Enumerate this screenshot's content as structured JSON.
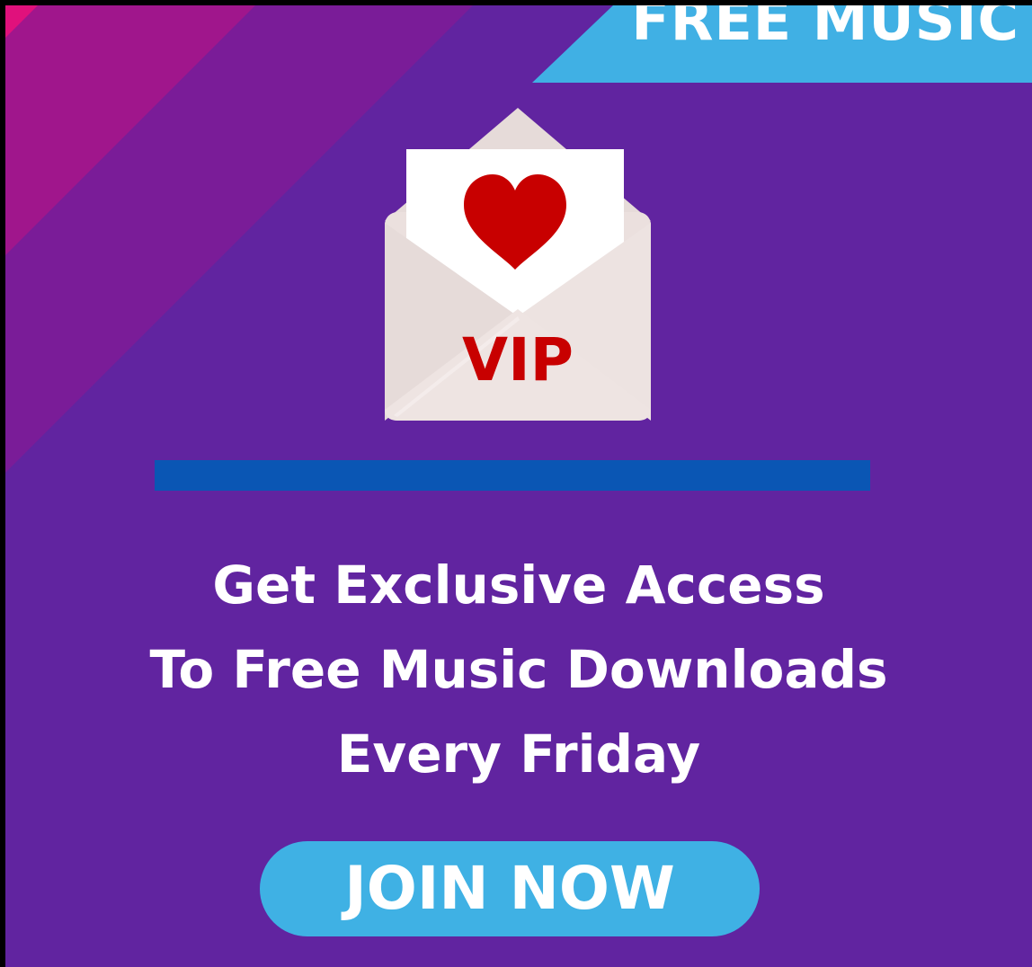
{
  "ribbon": {
    "label": "FREE MUSIC",
    "color": "#40b0e4"
  },
  "envelope": {
    "icon": "heart-icon",
    "badge": "VIP",
    "badge_color": "#c80000",
    "heart_color": "#c80000"
  },
  "headline": {
    "line1": "Get Exclusive Access",
    "line2": "To Free Music Downloads",
    "line3": "Every Friday"
  },
  "cta": {
    "label": "JOIN NOW",
    "color": "#3fb1e4"
  },
  "colors": {
    "background": "#6124a0",
    "stripe_pink": "#e0117c",
    "stripe_magenta": "#a0168c",
    "stripe_violet": "#7a1c98",
    "divider": "#0a56b4"
  }
}
